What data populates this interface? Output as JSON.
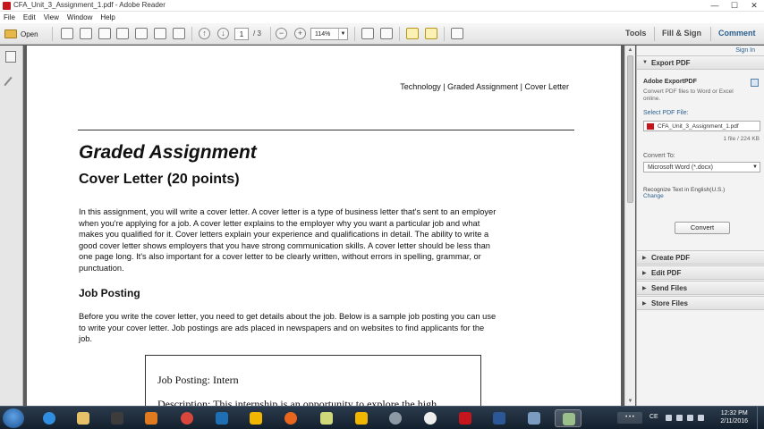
{
  "window": {
    "title": "CFA_Unit_3_Assignment_1.pdf - Adobe Reader",
    "minimize": "—",
    "maximize": "☐",
    "close": "✕"
  },
  "menu": [
    "File",
    "Edit",
    "View",
    "Window",
    "Help"
  ],
  "toolbar": {
    "open_label": "Open",
    "page_current": "1",
    "page_total": "/ 3",
    "zoom": "114%",
    "tools_label": "Tools",
    "fill_sign_label": "Fill & Sign",
    "comment_label": "Comment"
  },
  "document": {
    "header_right": "Technology | Graded Assignment | Cover Letter",
    "title": "Graded Assignment",
    "subtitle": "Cover Letter (20 points)",
    "para1": [
      "In this assignment, you will write a cover letter. A cover letter is a type of business letter that's sent to an employer",
      "when you're applying for a job. A cover letter explains to the employer why you want a particular job and what",
      "makes you qualified for it.  Cover letters explain your experience and qualifications in detail. The ability to write a",
      "good cover letter shows employers that you have strong communication skills. A cover letter should be less than",
      "one page long. It's also important for a cover letter to be clearly written, without errors in spelling, grammar, or",
      "punctuation."
    ],
    "section_heading": "Job Posting",
    "para2": [
      "Before you write the cover letter, you need to get details about the job. Below is a sample job posting you can use",
      "to write your cover letter. Job postings are ads placed in newspapers and on websites to find applicants for the",
      "job."
    ],
    "job_box_title": "Job Posting: Intern",
    "job_box_desc": "Description: This internship is an opportunity to explore the high"
  },
  "right_pane": {
    "sign_in": "Sign In",
    "export_header": "Export PDF",
    "service_name": "Adobe ExportPDF",
    "service_desc": "Convert PDF files to Word or Excel online.",
    "select_file_label": "Select PDF File:",
    "file_name": "CFA_Unit_3_Assignment_1.pdf",
    "file_info": "1 file / 224 KB",
    "convert_to_label": "Convert To:",
    "convert_to_value": "Microsoft Word (*.docx)",
    "recognize_text": "Recognize Text in English(U.S.)",
    "change_link": "Change",
    "convert_button": "Convert",
    "sections": [
      "Create PDF",
      "Edit PDF",
      "Send Files",
      "Store Files"
    ]
  },
  "taskbar": {
    "tray_lang": "CE",
    "clock_time": "12:32 PM",
    "clock_date": "2/11/2016",
    "tray_box": "• • •"
  },
  "colors": {
    "accent_blue": "#2a5f8f",
    "adobe_red": "#c4161c",
    "taskbar": "#1b2a3a"
  }
}
